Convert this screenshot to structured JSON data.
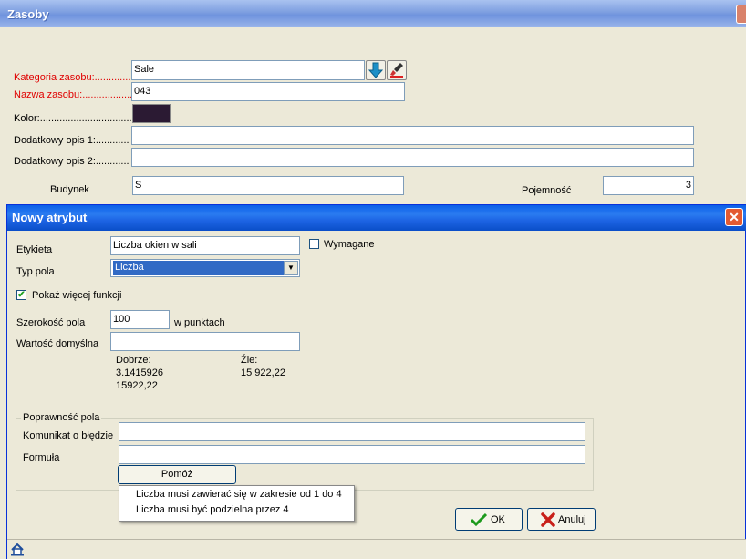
{
  "back_window": {
    "title": "Zasoby",
    "category_label": "Kategoria zasobu:",
    "category_dots": "...............",
    "category_value": "Sale",
    "name_label": "Nazwa zasobu:",
    "name_dots": "...................",
    "name_value": "043",
    "color_label": "Kolor:",
    "color_dots": ".........................................",
    "color_swatch": "#2b1a33",
    "desc1_label": "Dodatkowy opis 1:",
    "desc1_dots": "............",
    "desc1_value": "",
    "desc2_label": "Dodatkowy opis 2:",
    "desc2_dots": "............",
    "desc2_value": "",
    "building_label": "Budynek",
    "building_value": "S",
    "capacity_label": "Pojemność",
    "capacity_value": "3",
    "arrow_icon": "arrow-down-icon",
    "brush_icon": "paintbrush-icon"
  },
  "dialog": {
    "title": "Nowy atrybut",
    "label_label": "Etykieta",
    "label_value": "Liczba okien w sali",
    "required_label": "Wymagane",
    "required_checked": false,
    "type_label": "Typ pola",
    "type_value": "Liczba",
    "more_label": "Pokaż więcej funkcji",
    "more_checked": true,
    "width_label": "Szerokość pola",
    "width_value": "100",
    "width_unit": "w punktach",
    "default_label": "Wartość domyślna",
    "default_value": "",
    "good_header": "Dobrze:",
    "good_1": "3.1415926",
    "good_2": "15922,22",
    "bad_header": "Źle:",
    "bad_1": "15 922,22",
    "validation_group": "Poprawność pola",
    "error_msg_label": "Komunikat o błędzie",
    "error_msg_value": "",
    "formula_label": "Formuła",
    "formula_value": "",
    "help_button": "Pomóż",
    "popup_items": [
      "Liczba musi zawierać się w zakresie od 1 do 4",
      "Liczba musi być podzielna przez 4"
    ],
    "ok_button": "OK",
    "cancel_button": "Anuluj"
  }
}
